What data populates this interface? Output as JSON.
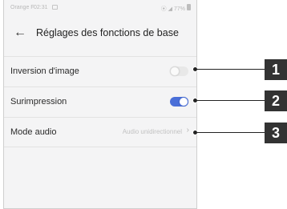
{
  "status_bar": {
    "carrier": "Orange F",
    "time": "02:31",
    "icons": "⦿ ◢ 77%"
  },
  "header": {
    "back_icon": "←",
    "title": "Réglages des fonctions de base"
  },
  "settings": {
    "inversion": {
      "label": "Inversion d'image",
      "enabled": false
    },
    "surimpression": {
      "label": "Surimpression",
      "enabled": true
    },
    "audio": {
      "label": "Mode audio",
      "value": "Audio unidirectionnel",
      "chevron": "›"
    }
  },
  "callouts": [
    "1",
    "2",
    "3"
  ],
  "colors": {
    "accent": "#4a6fd8",
    "background": "#f4f4f5",
    "badge": "#333333"
  }
}
